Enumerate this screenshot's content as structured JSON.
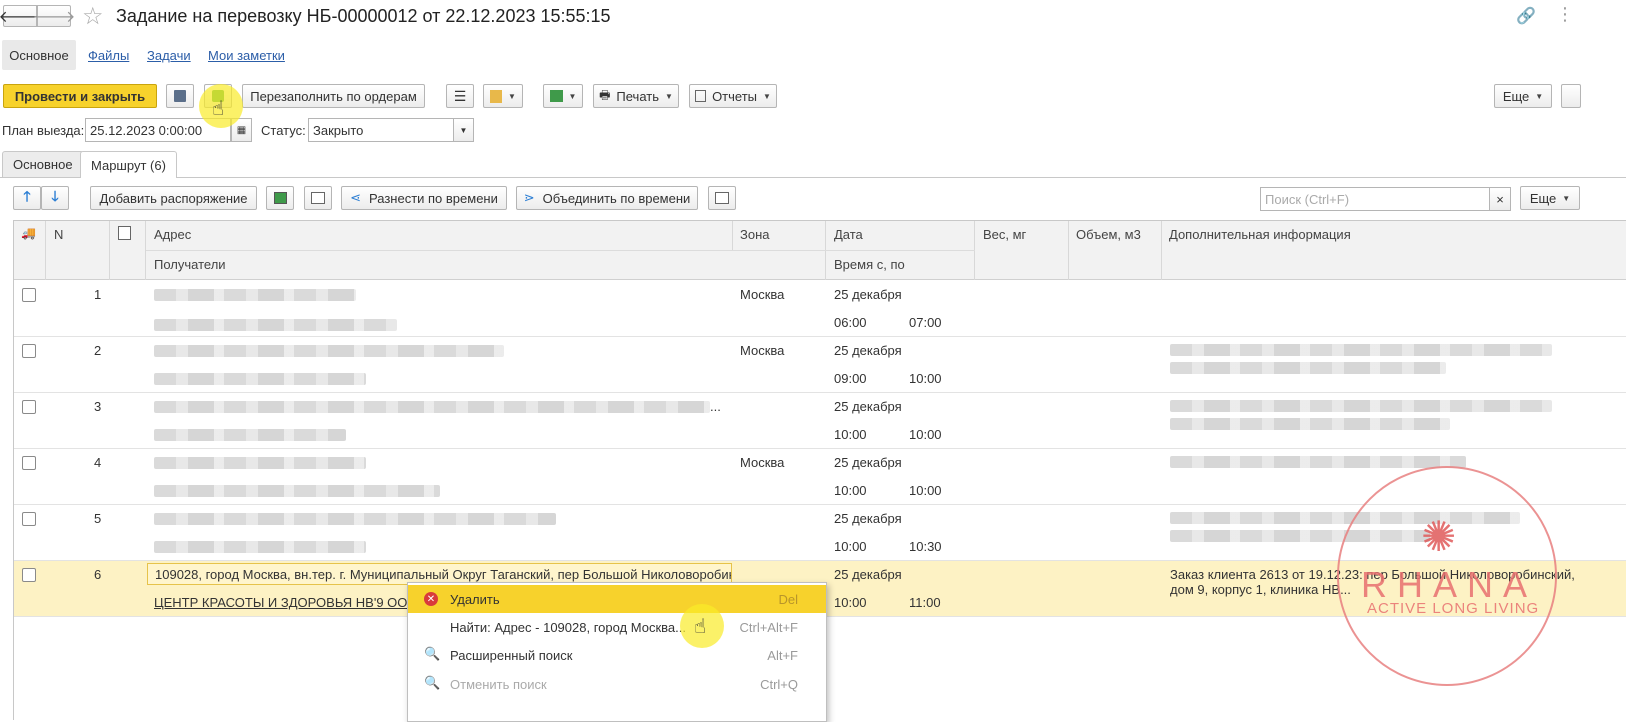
{
  "window": {
    "title": "Задание на перевозку НБ-00000012 от 22.12.2023 15:55:15"
  },
  "nav": {
    "tabs": [
      "Основное",
      "Файлы",
      "Задачи",
      "Мои заметки"
    ]
  },
  "toolbar": {
    "post_close": "Провести и закрыть",
    "refill": "Перезаполнить по ордерам",
    "print": "Печать",
    "reports": "Отчеты",
    "more": "Еще"
  },
  "form": {
    "plan_label": "План выезда:",
    "plan_value": "25.12.2023  0:00:00",
    "status_label": "Статус:",
    "status_value": "Закрыто"
  },
  "subtabs": {
    "main": "Основное",
    "route": "Маршрут (6)"
  },
  "route_toolbar": {
    "add_order": "Добавить распоряжение",
    "distribute": "Разнести по времени",
    "merge": "Объединить по времени",
    "search_placeholder": "Поиск (Ctrl+F)",
    "clear": "×",
    "more": "Еще"
  },
  "table": {
    "headers": {
      "n": "N",
      "address": "Адрес",
      "recipients": "Получатели",
      "zone": "Зона",
      "date": "Дата",
      "time": "Время с, по",
      "weight": "Вес, мг",
      "volume": "Объем, м3",
      "info": "Дополнительная информация"
    },
    "rows": [
      {
        "n": "1",
        "zone": "Москва",
        "date": "25 декабря",
        "from": "06:00",
        "to": "07:00"
      },
      {
        "n": "2",
        "zone": "Москва",
        "date": "25 декабря",
        "from": "09:00",
        "to": "10:00"
      },
      {
        "n": "3",
        "zone": "",
        "date": "25 декабря",
        "from": "10:00",
        "to": "10:00",
        "ellipsis": "..."
      },
      {
        "n": "4",
        "zone": "Москва",
        "date": "25 декабря",
        "from": "10:00",
        "to": "10:00"
      },
      {
        "n": "5",
        "zone": "",
        "date": "25 декабря",
        "from": "10:00",
        "to": "10:30"
      },
      {
        "n": "6",
        "address": "109028, город Москва, вн.тер. г. Муниципальный Округ Таганский, пер Большой Николоворобин...",
        "recipient": "ЦЕНТР КРАСОТЫ И ЗДОРОВЬЯ НВ'9 ООО",
        "date": "25 декабря",
        "from": "10:00",
        "to": "11:00",
        "info_line1": "Заказ клиента 2613 от 19.12.23: пер Большой Николоворобинский,",
        "info_line2": "дом 9, корпус 1, клиника НВ..."
      }
    ]
  },
  "context_menu": {
    "items": [
      {
        "label": "Удалить",
        "shortcut": "Del"
      },
      {
        "label": "Найти: Адрес - 109028, город Москва...",
        "shortcut": "Ctrl+Alt+F"
      },
      {
        "label": "Расширенный поиск",
        "shortcut": "Alt+F"
      },
      {
        "label": "Отменить поиск",
        "shortcut": "Ctrl+Q"
      }
    ]
  },
  "watermark": {
    "brand": "RHANA",
    "tagline": "ACTIVE LONG LIVING",
    "color": "#e05a5a"
  },
  "colors": {
    "accent_yellow": "#f7d22c",
    "selected_row": "#fdf2c4",
    "link_blue": "#2c5ea8"
  }
}
